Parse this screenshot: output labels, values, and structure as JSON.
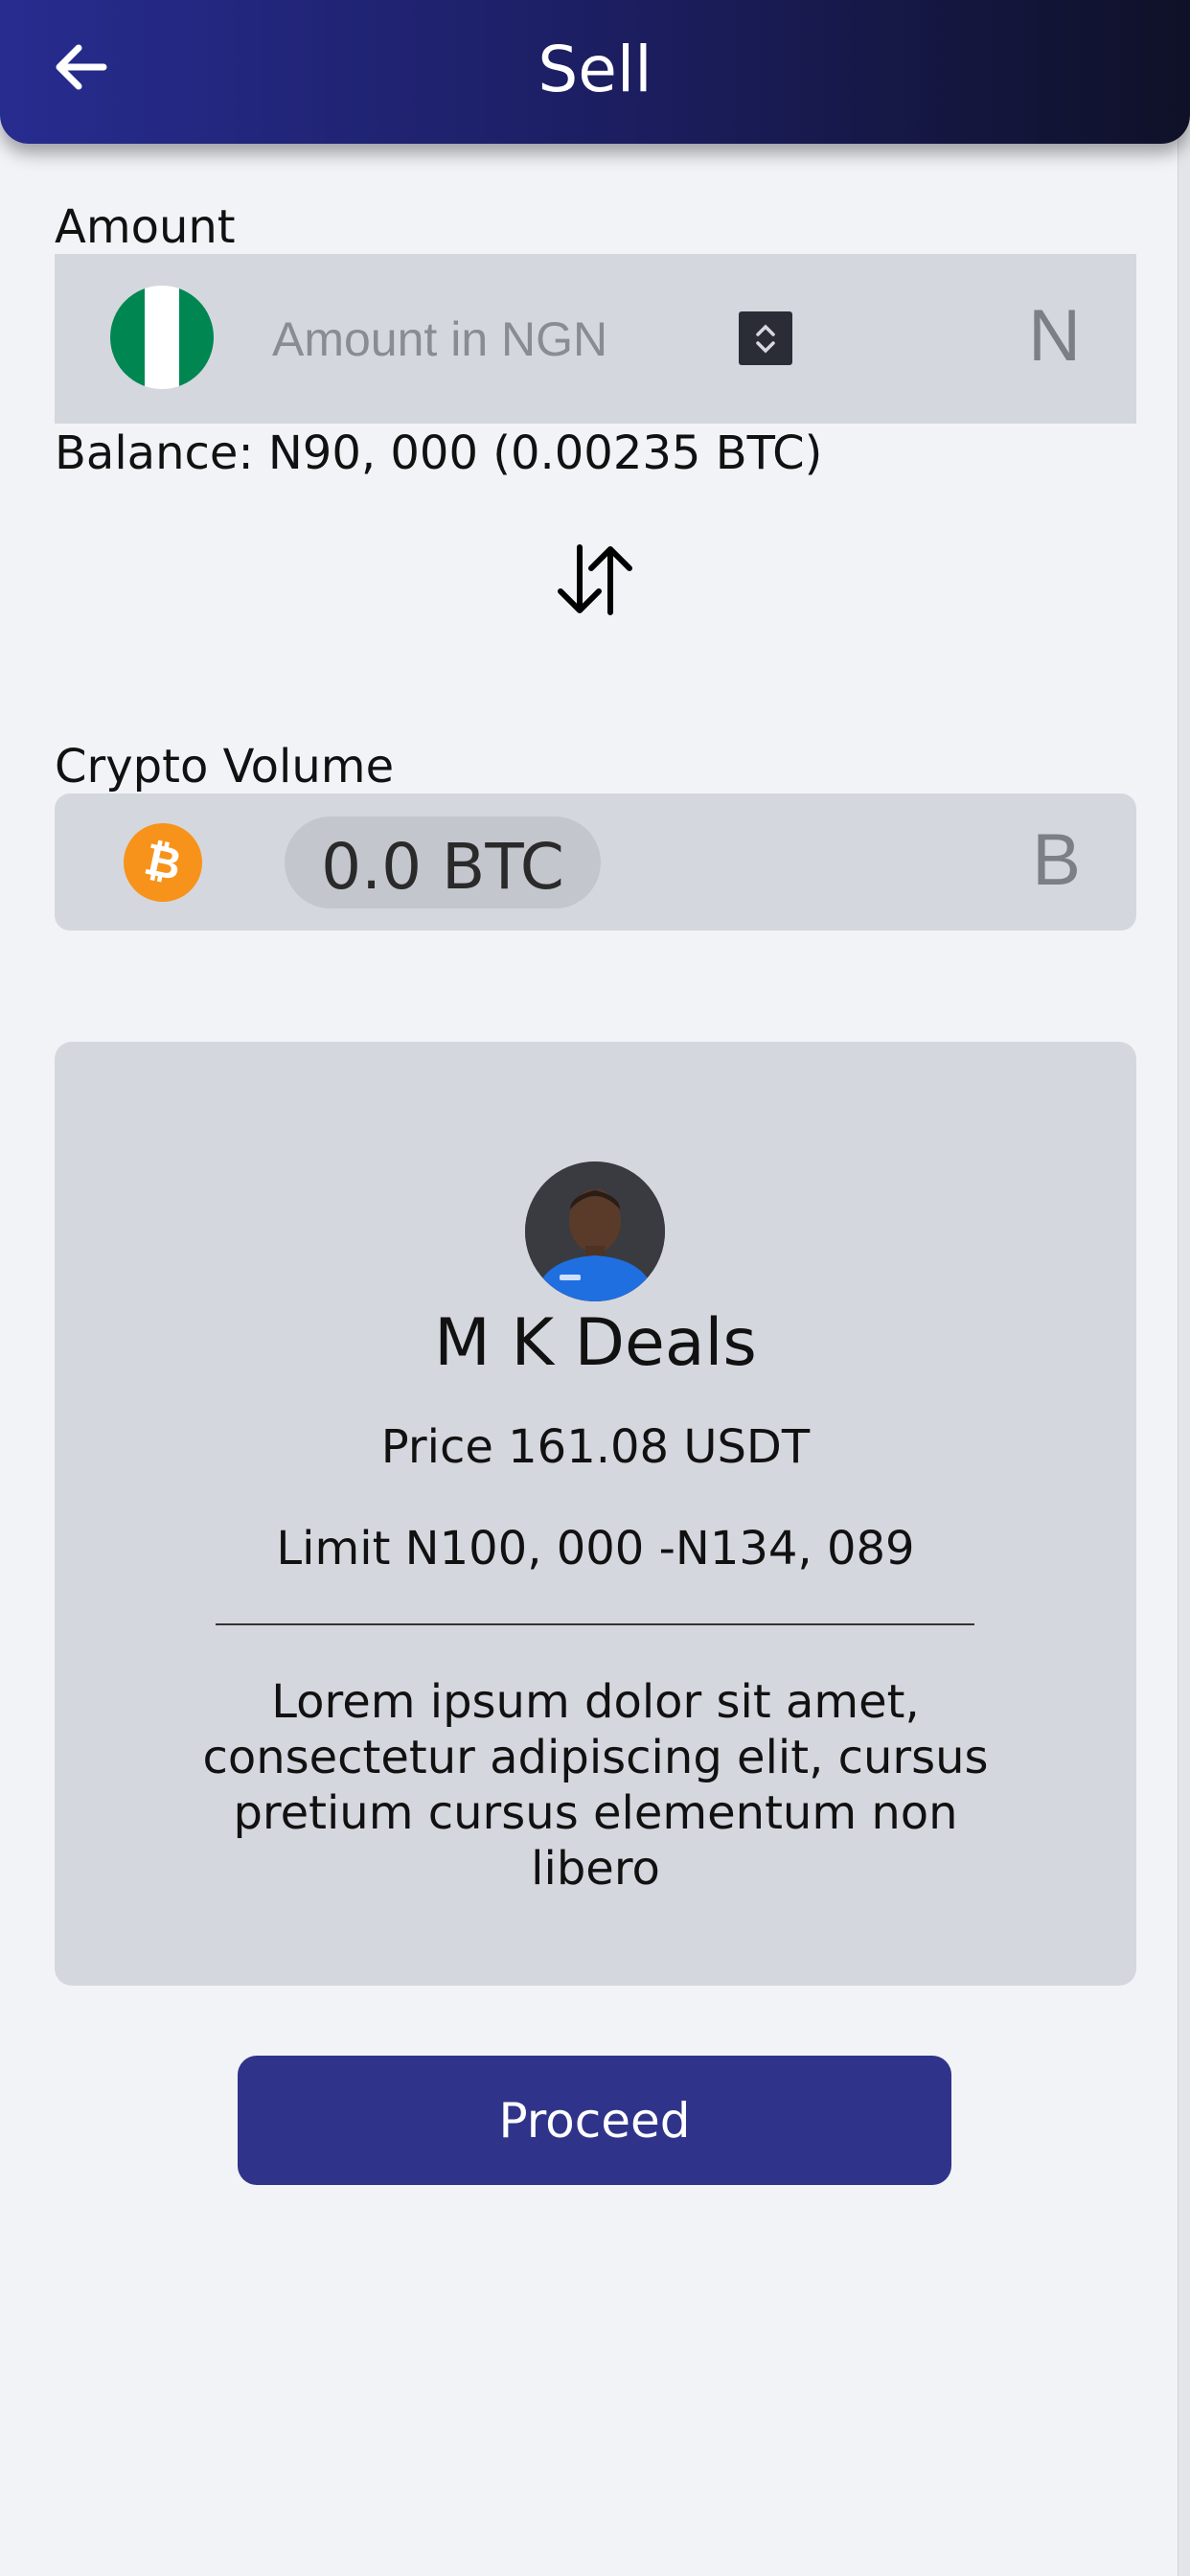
{
  "header": {
    "title": "Sell",
    "back_icon": "arrow-left-icon",
    "gradient": [
      "#272c8f",
      "#1b1d5e",
      "#0f1128"
    ]
  },
  "amount": {
    "label": "Amount",
    "placeholder": "Amount in NGN",
    "value": "",
    "currency_symbol": "N",
    "flag_icon": "nigeria-flag-icon",
    "flag_colors": [
      "#008751",
      "#ffffff",
      "#008751"
    ]
  },
  "balance": {
    "text": "Balance: N90, 000 (0.00235 BTC)"
  },
  "swap": {
    "icon": "swap-vertical-arrows-icon"
  },
  "crypto": {
    "label": "Crypto Volume",
    "value": "0.0 BTC",
    "symbol": "B",
    "icon": "bitcoin-icon",
    "icon_color": "#f7931a"
  },
  "offer": {
    "avatar": "seller-avatar",
    "seller_name": "M K Deals",
    "price": "Price 161.08 USDT",
    "limit": "Limit N100, 000 -N134, 089",
    "description": "Lorem ipsum dolor sit amet, consectetur adipiscing elit, cursus pretium cursus elementum non libero"
  },
  "actions": {
    "proceed_label": "Proceed",
    "proceed_color": "#2f348a"
  }
}
